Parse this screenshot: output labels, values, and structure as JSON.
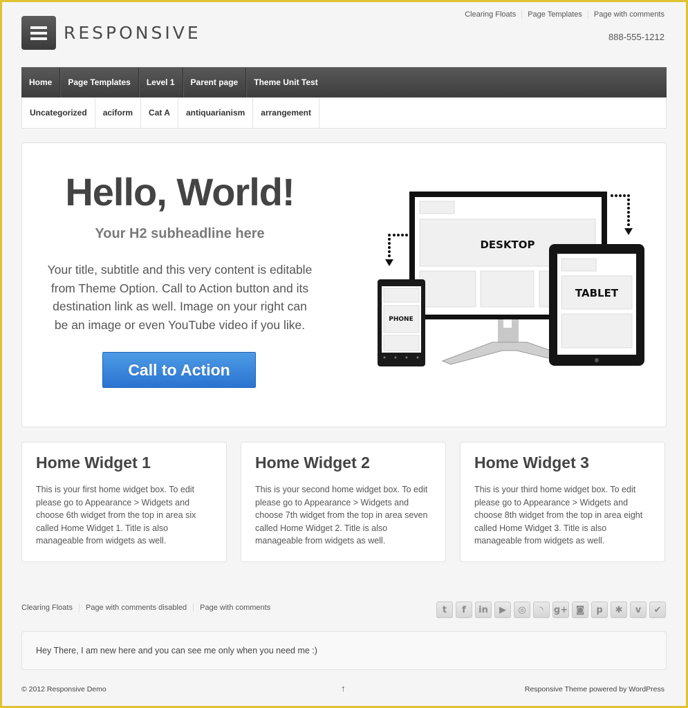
{
  "site": {
    "name": "RESPONSIVE",
    "phone": "888-555-1212"
  },
  "top_menu": [
    "Clearing Floats",
    "Page Templates",
    "Page with comments"
  ],
  "main_nav": [
    "Home",
    "Page Templates",
    "Level 1",
    "Parent page",
    "Theme Unit Test"
  ],
  "sub_nav": [
    "Uncategorized",
    "aciform",
    "Cat A",
    "antiquarianism",
    "arrangement"
  ],
  "featured": {
    "title": "Hello, World!",
    "subtitle": "Your H2 subheadline here",
    "text": "Your title, subtitle and this very content is editable from Theme Option. Call to Action button and its destination link as well. Image on your right can be an image or even YouTube video if you like.",
    "cta_label": "Call to Action",
    "cta_color": "#2a74d0",
    "image_labels": {
      "desktop": "DESKTOP",
      "tablet": "TABLET",
      "phone": "PHONE"
    }
  },
  "widgets": [
    {
      "title": "Home Widget 1",
      "text": "This is your first home widget box. To edit please go to Appearance > Widgets and choose 6th widget from the top in area six called Home Widget 1. Title is also manageable from widgets as well."
    },
    {
      "title": "Home Widget 2",
      "text": "This is your second home widget box. To edit please go to Appearance > Widgets and choose 7th widget from the top in area seven called Home Widget 2. Title is also manageable from widgets as well."
    },
    {
      "title": "Home Widget 3",
      "text": "This is your third home widget box. To edit please go to Appearance > Widgets and choose 8th widget from the top in area eight called Home Widget 3. Title is also manageable from widgets as well."
    }
  ],
  "footer": {
    "menu": [
      "Clearing Floats",
      "Page with comments disabled",
      "Page with comments"
    ],
    "social": [
      {
        "name": "twitter-icon",
        "glyph": "t"
      },
      {
        "name": "facebook-icon",
        "glyph": "f"
      },
      {
        "name": "linkedin-icon",
        "glyph": "in"
      },
      {
        "name": "youtube-icon",
        "glyph": "▶"
      },
      {
        "name": "stumbleupon-icon",
        "glyph": "◎"
      },
      {
        "name": "rss-icon",
        "glyph": "◝"
      },
      {
        "name": "google-plus-icon",
        "glyph": "g+"
      },
      {
        "name": "instagram-icon",
        "glyph": "◙"
      },
      {
        "name": "pinterest-icon",
        "glyph": "p"
      },
      {
        "name": "yelp-icon",
        "glyph": "✱"
      },
      {
        "name": "vimeo-icon",
        "glyph": "v"
      },
      {
        "name": "foursquare-icon",
        "glyph": "✔"
      }
    ],
    "colophon_text": "Hey There, I am new here and you can see me only when you need me :)",
    "copyright": "© 2012 Responsive Demo",
    "scroll_top": "↑",
    "powered_by": "Responsive Theme powered by WordPress"
  },
  "accent": {
    "frame_border": "#e0c231",
    "nav_dark": "#3d3d3d"
  }
}
